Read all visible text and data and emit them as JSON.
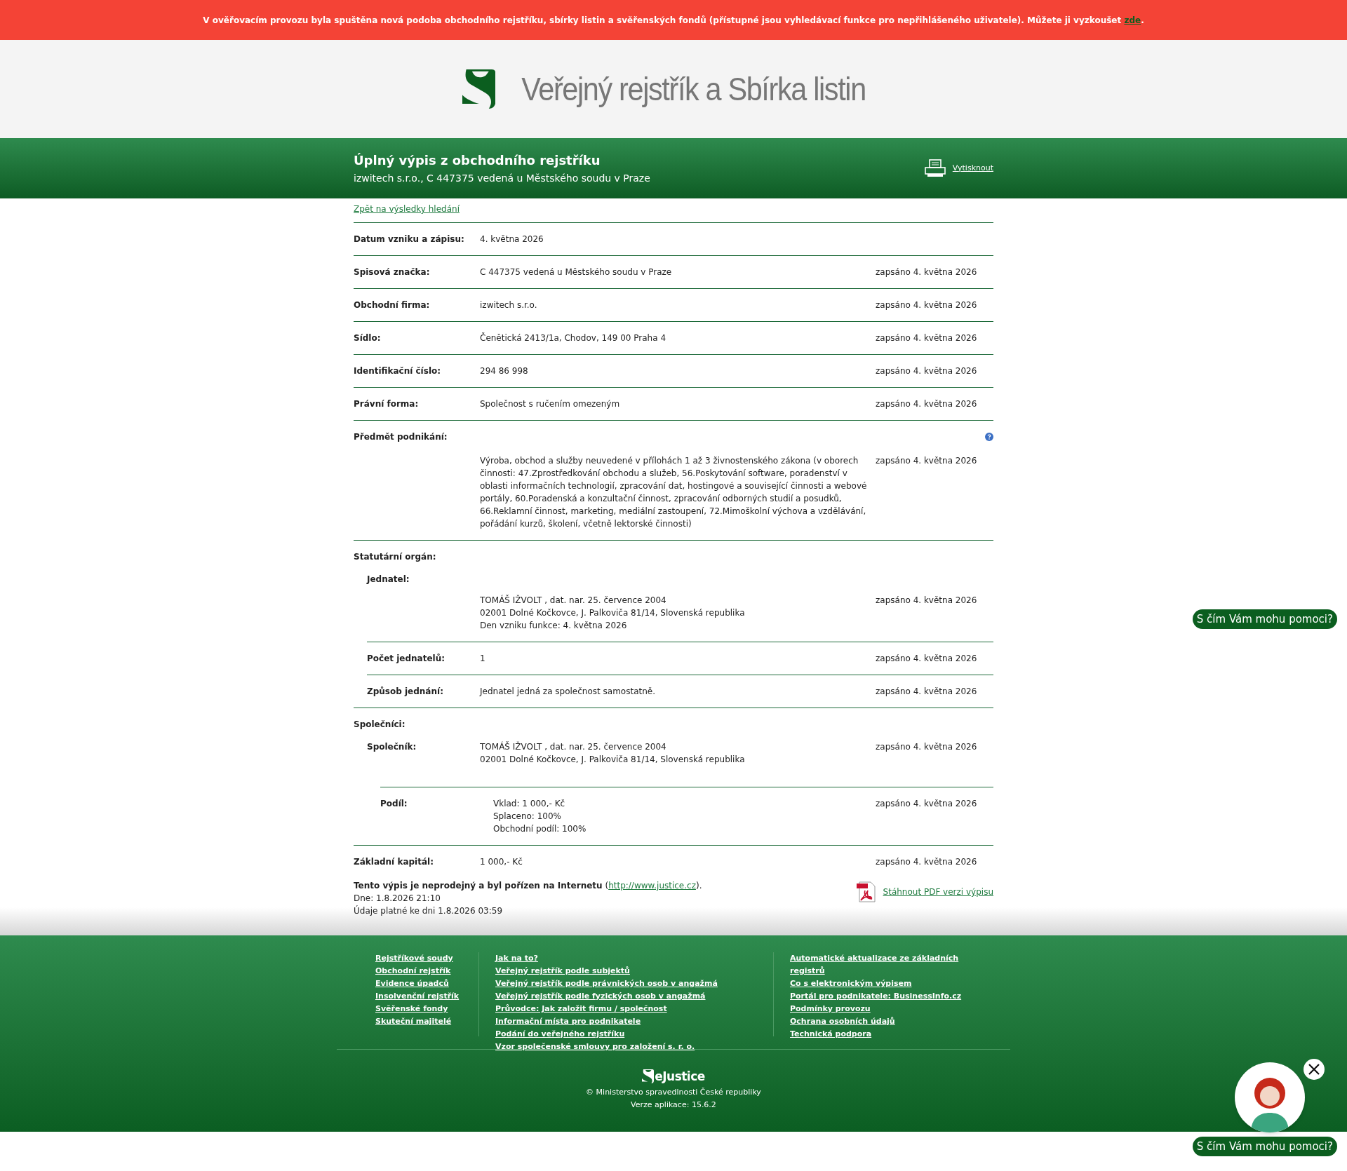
{
  "banner": {
    "text": "V ověřovacím provozu byla spuštěna nová podoba obchodního rejstříku, sbírky listin a svěřenských fondů (přístupné jsou vyhledávací funkce pro nepřihlášeného uživatele). Můžete ji vyzkoušet ",
    "link": "zde",
    "tail": "."
  },
  "header": {
    "logo_text": "Veřejný rejstřík a Sbírka listin"
  },
  "title_bar": {
    "title": "Úplný výpis z obchodního rejstříku",
    "subtitle": "izwitech s.r.o., C 447375 vedená u Městského soudu v Praze",
    "print_link": "Vytisknout"
  },
  "back_link": "Zpět na výsledky hledání",
  "entries": [
    {
      "kind": "row",
      "label": "Datum vzniku a zápisu:",
      "lines": [
        "4. května 2026"
      ]
    },
    {
      "kind": "row",
      "label": "Spisová značka:",
      "lines": [
        "C 447375 vedená u Městského soudu v Praze"
      ],
      "recorded": "zapsáno 4. května 2026"
    },
    {
      "kind": "row",
      "label": "Obchodní firma:",
      "lines": [
        "izwitech s.r.o."
      ],
      "recorded": "zapsáno 4. května 2026"
    },
    {
      "kind": "row",
      "label": "Sídlo:",
      "lines": [
        "Čenětická 2413/1a, Chodov, 149 00 Praha 4"
      ],
      "recorded": "zapsáno 4. května 2026"
    },
    {
      "kind": "row",
      "label": "Identifikační číslo:",
      "lines": [
        "294 86 998"
      ],
      "recorded": "zapsáno 4. května 2026"
    },
    {
      "kind": "row",
      "label": "Právní forma:",
      "lines": [
        "Společnost s ručením omezeným"
      ],
      "recorded": "zapsáno 4. května 2026"
    },
    {
      "kind": "block",
      "label": "Předmět podnikání:",
      "help": true,
      "lines": [
        "Výroba, obchod a služby neuvedené v přílohách 1 až 3 živnostenského zákona (v oborech činnosti: 47.Zprostředkování obchodu a služeb, 56.Poskytování software, poradenství v oblasti informačních technologií, zpracování dat, hostingové a související činnosti a webové portály, 60.Poradenská a konzultační činnost, zpracování odborných studií a posudků, 66.Reklamní činnost, marketing, mediální zastoupení, 72.Mimoškolní výchova a vzdělávání, pořádání kurzů, školení, včetně lektorské činnosti)"
      ],
      "recorded": "zapsáno 4. května 2026"
    },
    {
      "kind": "group",
      "label": "Statutární orgán:",
      "children": [
        {
          "kind": "block",
          "label": "Jednatel:",
          "lines": [
            "TOMÁŠ IŽVOLT , dat. nar. 25. července 2004",
            "02001 Dolné Kočkovce, J. Palkoviča 81/14, Slovenská republika",
            "Den vzniku funkce: 4. května 2026"
          ],
          "recorded": "zapsáno 4. května 2026"
        },
        {
          "kind": "row",
          "label": "Počet jednatelů:",
          "lines": [
            "1"
          ],
          "recorded": "zapsáno 4. května 2026"
        },
        {
          "kind": "row",
          "label": "Způsob jednání:",
          "lines": [
            "Jednatel jedná za společnost samostatně."
          ],
          "recorded": "zapsáno 4. května 2026"
        }
      ]
    },
    {
      "kind": "group",
      "label": "Společníci:",
      "children": [
        {
          "kind": "row",
          "label": "Společník:",
          "lines": [
            "TOMÁŠ IŽVOLT , dat. nar. 25. července 2004",
            "02001 Dolné Kočkovce, J. Palkoviča 81/14, Slovenská republika"
          ],
          "recorded": "zapsáno 4. května 2026",
          "children": [
            {
              "kind": "row",
              "label": "Podíl:",
              "lines": [
                "Vklad: 1 000,- Kč",
                "Splaceno: 100%",
                "Obchodní podíl: 100%"
              ],
              "recorded": "zapsáno 4. května 2026"
            }
          ]
        }
      ]
    },
    {
      "kind": "row",
      "label": "Základní kapitál:",
      "lines": [
        "1 000,- Kč"
      ],
      "recorded": "zapsáno 4. května 2026"
    }
  ],
  "notice": {
    "text": "**Tento výpis je neprodejný a byl pořízen na Internetu** (",
    "link": "http://www.justice.cz",
    "text_after": ").",
    "date": "Dne: 1.8.2026 21:10",
    "valid": "Údaje platné ke dni 1.8.2026 03:59",
    "pdf_link": "Stáhnout PDF verzi výpisu"
  },
  "footer": {
    "columns": [
      [
        "Rejstříkové soudy",
        "Obchodní rejstřík",
        "Evidence úpadců",
        "Insolvenční rejstřík",
        "Svěřenské fondy",
        "Skuteční majitelé"
      ],
      [
        "Jak na to?",
        "Veřejný rejstřík podle subjektů",
        "Veřejný rejstřík podle právnických osob v angažmá",
        "Veřejný rejstřík podle fyzických osob v angažmá",
        "Průvodce: Jak založit firmu / společnost",
        "Informační místa pro podnikatele",
        "Podání do veřejného rejstříku",
        "Vzor společenské smlouvy pro založení s. r. o."
      ],
      [
        "Automatické aktualizace ze základních registrů",
        "Co s elektronickým výpisem",
        "Portál pro podnikatele: BusinessInfo.cz",
        "Podmínky provozu",
        "Ochrana osobních údajů",
        "Technická podpora"
      ]
    ],
    "brand": "eJustice",
    "copyright": "© Ministerstvo spravedlnosti České republiky",
    "version": "Verze aplikace: 15.6.2"
  },
  "chat": {
    "prompts": [
      "S čím Vám mohu pomoci?",
      "S čím Vám mohu pomoci?"
    ]
  }
}
